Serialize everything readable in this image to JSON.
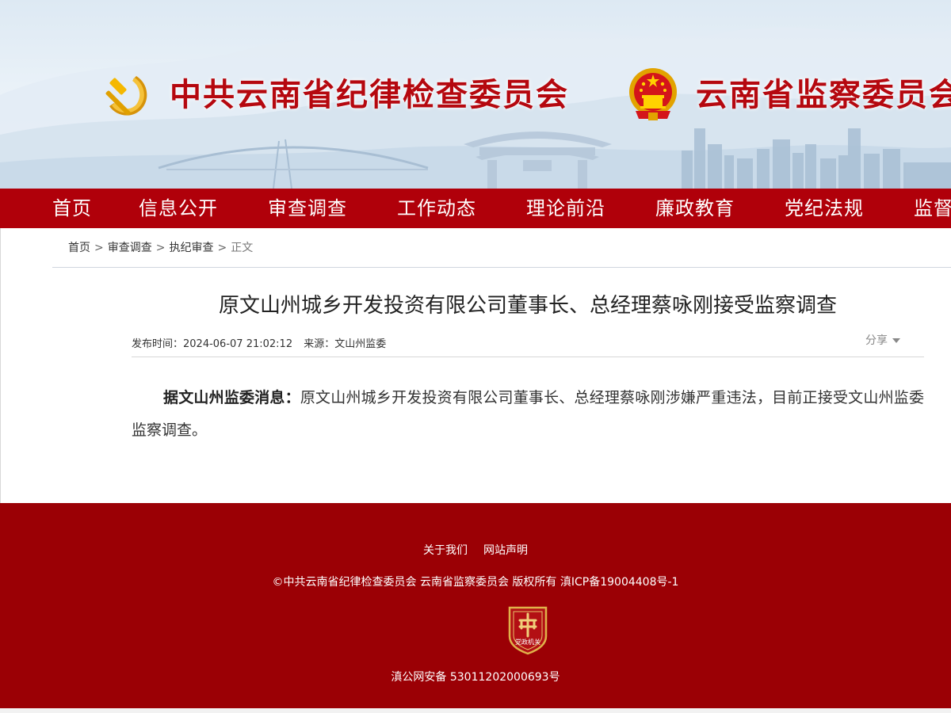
{
  "header": {
    "party_org_name": "中共云南省纪律检查委员会",
    "state_org_name": "云南省监察委员会"
  },
  "nav": {
    "items": [
      {
        "label": "首页"
      },
      {
        "label": "信息公开"
      },
      {
        "label": "审查调查"
      },
      {
        "label": "工作动态"
      },
      {
        "label": "理论前沿"
      },
      {
        "label": "廉政教育"
      },
      {
        "label": "党纪法规"
      },
      {
        "label": "监督"
      }
    ]
  },
  "breadcrumb": {
    "items": [
      "首页",
      "审查调查",
      "执纪审查"
    ],
    "current": "正文",
    "separator": ">"
  },
  "article": {
    "title": "原文山州城乡开发投资有限公司董事长、总经理蔡咏刚接受监察调查",
    "publish_time_label": "发布时间：",
    "publish_time": "2024-06-07 21:02:12",
    "source_label": "来源：",
    "source": "文山州监委",
    "share_label": "分享",
    "lead": "据文山州监委消息：",
    "body": "原文山州城乡开发投资有限公司董事长、总经理蔡咏刚涉嫌严重违法，目前正接受文山州监委监察调查。"
  },
  "footer": {
    "links": [
      "关于我们",
      "网站声明"
    ],
    "copyright": "©中共云南省纪律检查委员会 云南省监察委员会 版权所有 滇ICP备19004408号-1",
    "badge_text": "党政机关",
    "police_record": "滇公网安备 53011202000693号"
  },
  "colors": {
    "primary_red": "#b0000a",
    "footer_red": "#9b0005",
    "title_red": "#b5080f",
    "emblem_gold": "#f2b500"
  },
  "icons": {
    "party_emblem": "hammer-sickle-icon",
    "state_emblem": "national-emblem-icon",
    "share_dropdown": "caret-down-icon",
    "footer_badge": "party-government-badge-icon"
  }
}
